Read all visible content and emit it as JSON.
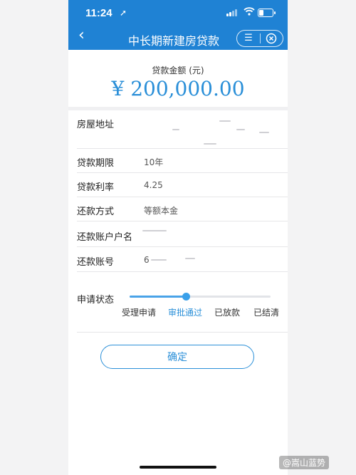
{
  "status_bar": {
    "time": "11:24",
    "location_glyph": "➚"
  },
  "nav": {
    "back_glyph": "‹",
    "title": "中长期新建房贷款",
    "menu_glyph": "☰"
  },
  "loan": {
    "amount_label": "贷款金额 (元)",
    "amount_value": "¥ 200,000.00"
  },
  "fields": [
    {
      "label": "房屋地址",
      "value": ""
    },
    {
      "label": "贷款期限",
      "value": "10年"
    },
    {
      "label": "贷款利率",
      "value": "4.25"
    },
    {
      "label": "还款方式",
      "value": "等额本金"
    },
    {
      "label": "还款账户户名",
      "value": ""
    },
    {
      "label": "还款账号",
      "value": "6"
    }
  ],
  "application_status": {
    "label": "申请状态",
    "steps": [
      "受理申请",
      "审批通过",
      "已放款",
      "已结清"
    ],
    "current_step_index": 1,
    "progress_fraction": 0.4
  },
  "confirm_button": "确定",
  "watermark": "@嵩山蓝势",
  "colors": {
    "header_blue": "#1f82d4",
    "accent_blue": "#2a8fd8"
  }
}
